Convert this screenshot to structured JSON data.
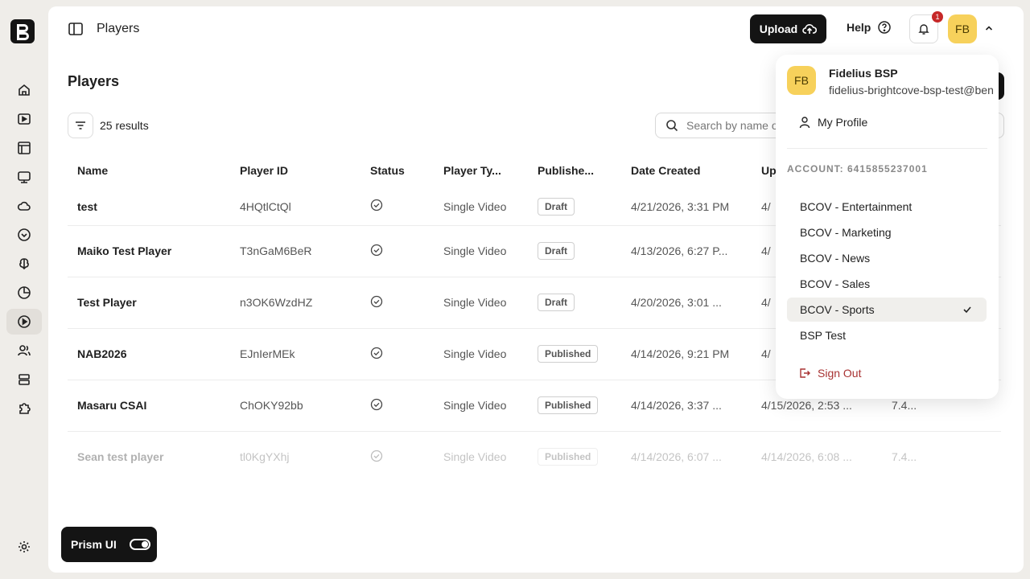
{
  "breadcrumb": "Players",
  "header": {
    "upload_label": "Upload",
    "help_label": "Help",
    "notification_count": "1",
    "avatar_initials": "FB"
  },
  "page": {
    "title": "Players",
    "results": "25 results",
    "search_placeholder": "Search by name or ID"
  },
  "table": {
    "headers": [
      "Name",
      "Player ID",
      "Status",
      "Player Ty...",
      "Publishe...",
      "Date Created",
      "Up"
    ],
    "rows": [
      {
        "name": "test",
        "id": "4HQtlCtQl",
        "type": "Single Video",
        "published": "Draft",
        "created": "4/21/2026, 3:31 PM",
        "updated": "4/",
        "extra": ""
      },
      {
        "name": "Maiko Test Player",
        "id": "T3nGaM6BeR",
        "type": "Single Video",
        "published": "Draft",
        "created": "4/13/2026, 6:27 P...",
        "updated": "4/",
        "extra": ""
      },
      {
        "name": "Test Player",
        "id": "n3OK6WzdHZ",
        "type": "Single Video",
        "published": "Draft",
        "created": "4/20/2026, 3:01 ...",
        "updated": "4/",
        "extra": ""
      },
      {
        "name": "NAB2026",
        "id": "EJnIerMEk",
        "type": "Single Video",
        "published": "Published",
        "created": "4/14/2026, 9:21 PM",
        "updated": "4/",
        "extra": ""
      },
      {
        "name": "Masaru CSAI",
        "id": "ChOKY92bb",
        "type": "Single Video",
        "published": "Published",
        "created": "4/14/2026, 3:37 ...",
        "updated": "4/15/2026, 2:53 ...",
        "extra": "7.4..."
      },
      {
        "name": "Sean test player",
        "id": "tl0KgYXhj",
        "type": "Single Video",
        "published": "Published",
        "created": "4/14/2026, 6:07 ...",
        "updated": "4/14/2026, 6:08 ...",
        "extra": "7.4..."
      }
    ]
  },
  "prism": {
    "label": "Prism UI"
  },
  "menu": {
    "avatar_initials": "FB",
    "name": "Fidelius BSP",
    "email": "fidelius-brightcove-bsp-test@ben",
    "profile_label": "My Profile",
    "account_label": "ACCOUNT: 6415855237001",
    "accounts": [
      "BCOV - Entertainment",
      "BCOV - Marketing",
      "BCOV - News",
      "BCOV - Sales",
      "BCOV - Sports",
      "BSP Test"
    ],
    "selected_account": "BCOV - Sports",
    "signout_label": "Sign Out"
  },
  "colors": {
    "accent_yellow": "#f7d15b",
    "dark": "#141414",
    "signout_red": "#a83232",
    "badge_red": "#c62828"
  },
  "icons": [
    "home-icon",
    "video-icon",
    "layout-icon",
    "monitor-icon",
    "cloud-icon",
    "badge-icon",
    "brain-icon",
    "chart-icon",
    "player-icon",
    "users-icon",
    "server-icon",
    "puzzle-icon",
    "settings-icon"
  ]
}
